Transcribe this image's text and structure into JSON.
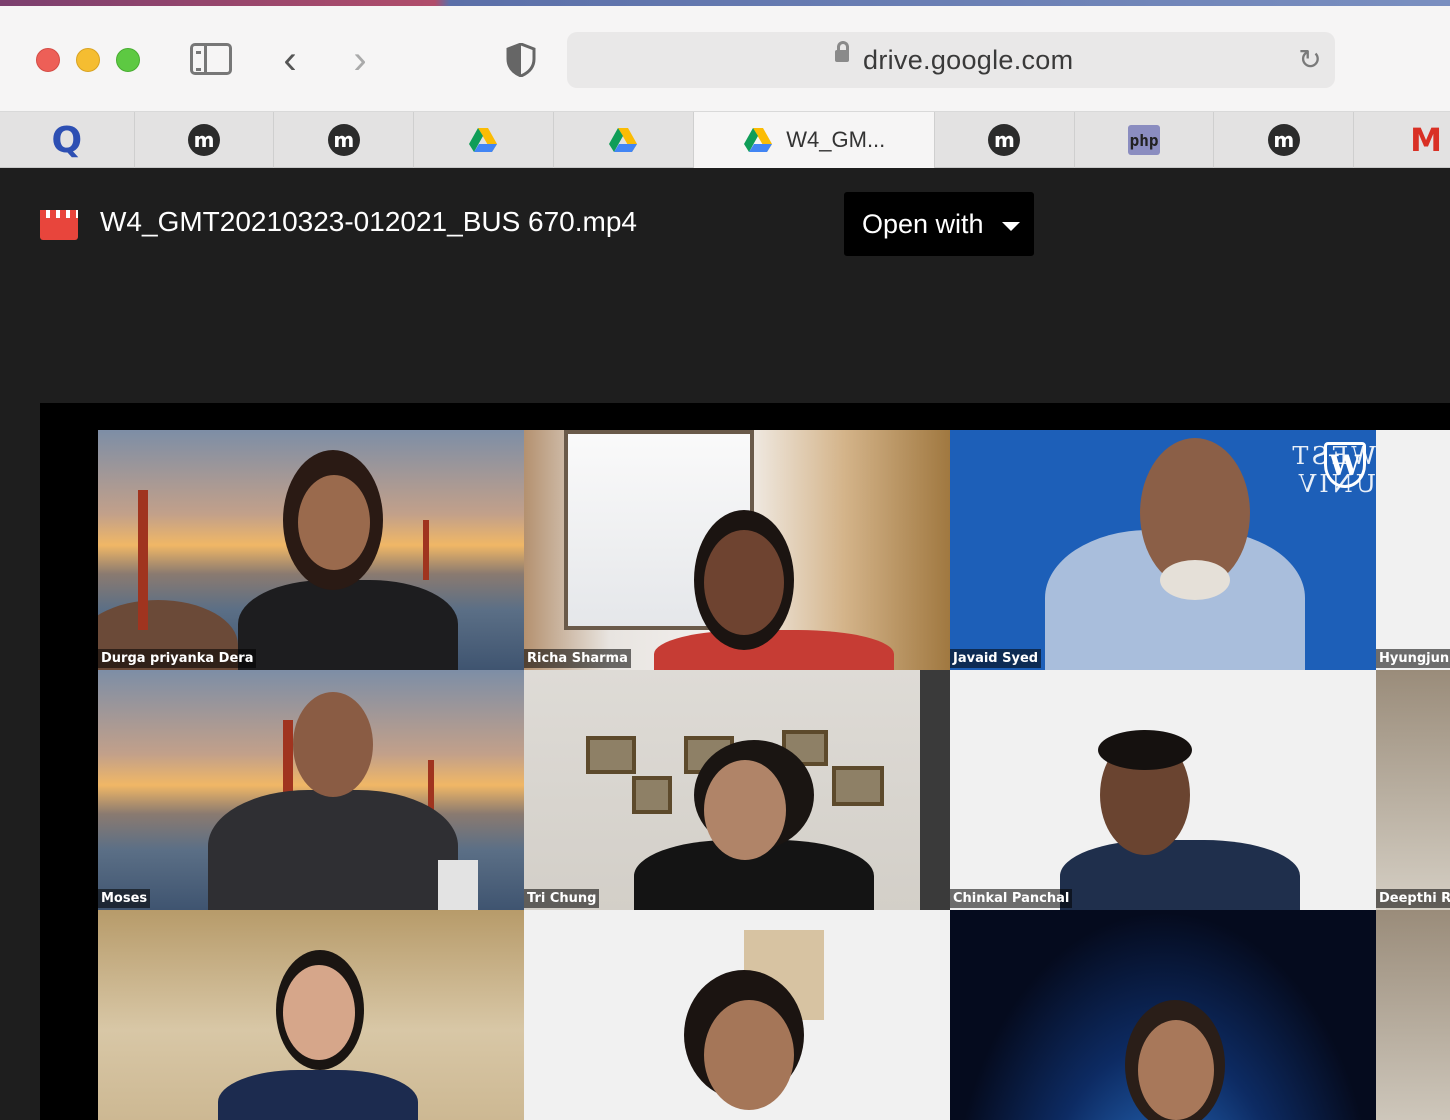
{
  "browser": {
    "url": "drive.google.com",
    "tabs": [
      {
        "icon": "q-icon",
        "glyph": "Q",
        "label": ""
      },
      {
        "icon": "m-icon",
        "glyph": "m",
        "label": ""
      },
      {
        "icon": "m-icon",
        "glyph": "m",
        "label": ""
      },
      {
        "icon": "google-drive-icon",
        "glyph": "",
        "label": ""
      },
      {
        "icon": "google-drive-icon",
        "glyph": "",
        "label": ""
      },
      {
        "icon": "google-drive-icon",
        "glyph": "",
        "label": "W4_GM..."
      },
      {
        "icon": "m-icon",
        "glyph": "m",
        "label": ""
      },
      {
        "icon": "php-icon",
        "glyph": "php",
        "label": ""
      },
      {
        "icon": "m-icon",
        "glyph": "m",
        "label": ""
      },
      {
        "icon": "gmail-icon",
        "glyph": "M",
        "label": ""
      }
    ]
  },
  "viewer": {
    "file_name": "W4_GMT20210323-012021_BUS 670.mp4",
    "open_with_label": "Open with"
  },
  "video": {
    "logo_text": "WEST UNIV",
    "logo_letter": "W",
    "participants": [
      {
        "name": "Durga priyanka Dera"
      },
      {
        "name": "Richa Sharma"
      },
      {
        "name": "Javaid Syed"
      },
      {
        "name": "Hyungjun Jo"
      },
      {
        "name": "Moses"
      },
      {
        "name": "Tri Chung"
      },
      {
        "name": "Chinkal Panchal"
      },
      {
        "name": "Deepthi Raje"
      },
      {
        "name": ""
      },
      {
        "name": ""
      },
      {
        "name": ""
      },
      {
        "name": ""
      }
    ]
  }
}
